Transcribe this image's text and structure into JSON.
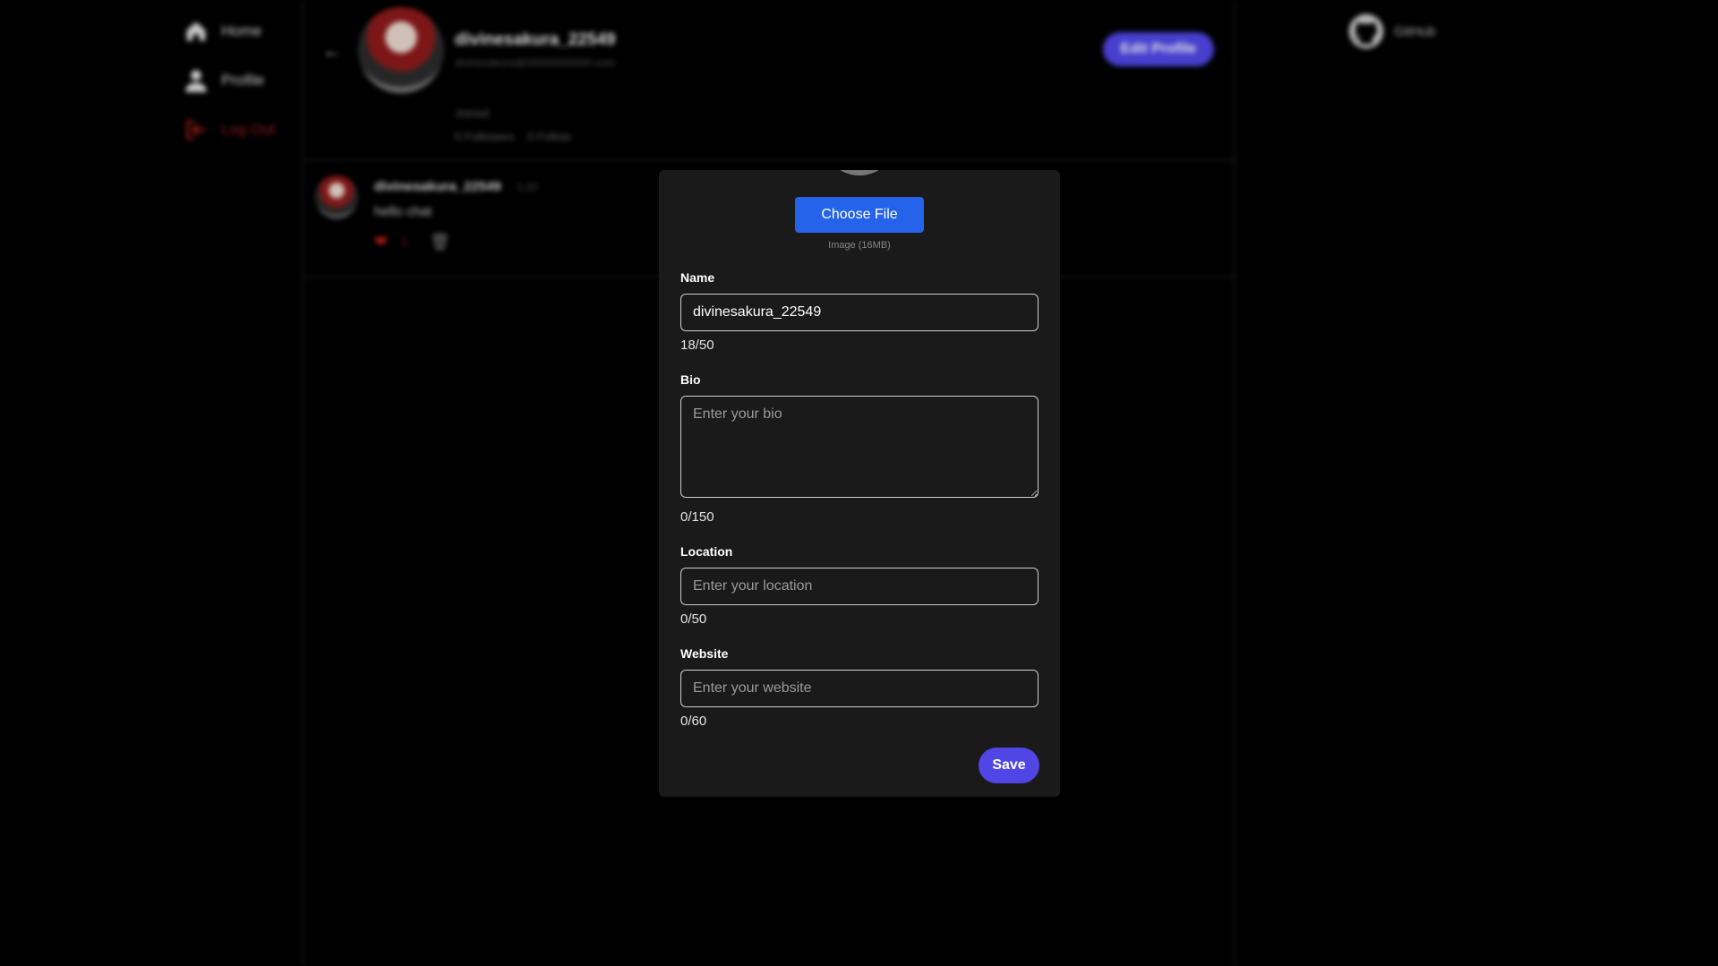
{
  "nav": {
    "home": "Home",
    "profile": "Profile",
    "logout": "Log Out"
  },
  "profile_header": {
    "name": "divinesakura_22549",
    "email": "divinesakura@00000000000.com",
    "joined": "Joined",
    "followers": "0 Followers",
    "following": "0 Follow",
    "edit_button": "Edit Profile"
  },
  "post": {
    "author": "divinesakura_22549",
    "time": "· 1:20",
    "text": "hello chat",
    "likes": "1"
  },
  "github": {
    "label": "GitHub"
  },
  "edit_modal": {
    "choose_file_label": "Choose File",
    "file_hint": "Image (16MB)",
    "name": {
      "label": "Name",
      "value": "divinesakura_22549",
      "counter": "18/50"
    },
    "bio": {
      "label": "Bio",
      "value": "",
      "placeholder": "Enter your bio",
      "counter": "0/150"
    },
    "location": {
      "label": "Location",
      "value": "",
      "placeholder": "Enter your location",
      "counter": "0/50"
    },
    "website": {
      "label": "Website",
      "value": "",
      "placeholder": "Enter your website",
      "counter": "0/60"
    },
    "save_label": "Save"
  },
  "colors": {
    "background": "#000000",
    "modal_background": "#1a1a1a",
    "choose_file_blue": "#2563eb",
    "save_indigo": "#4f46e5",
    "logout_red": "#9b1c1c"
  }
}
